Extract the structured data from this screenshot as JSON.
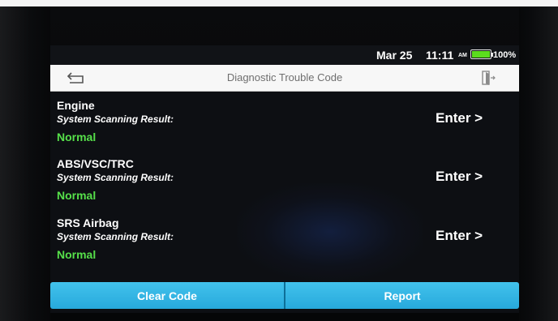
{
  "status_bar": {
    "date": "Mar 25",
    "time": "11:11",
    "ampm": "AM",
    "battery_pct": "100%",
    "battery_level": 1.0,
    "battery_color": "#5bdc1e"
  },
  "header": {
    "title": "Diagnostic Trouble Code",
    "back_icon": "back-arrow-icon",
    "exit_icon": "exit-icon"
  },
  "systems": [
    {
      "name": "Engine",
      "result_label": "System Scanning Result:",
      "status": "Normal",
      "action": "Enter >"
    },
    {
      "name": "ABS/VSC/TRC",
      "result_label": "System Scanning Result:",
      "status": "Normal",
      "action": "Enter >"
    },
    {
      "name": "SRS Airbag",
      "result_label": "System Scanning Result:",
      "status": "Normal",
      "action": "Enter >"
    }
  ],
  "footer": {
    "clear_label": "Clear Code",
    "report_label": "Report"
  },
  "colors": {
    "status_normal": "#56e04a",
    "button": "#2fb3e3",
    "screen_bg": "#0d0f13"
  }
}
